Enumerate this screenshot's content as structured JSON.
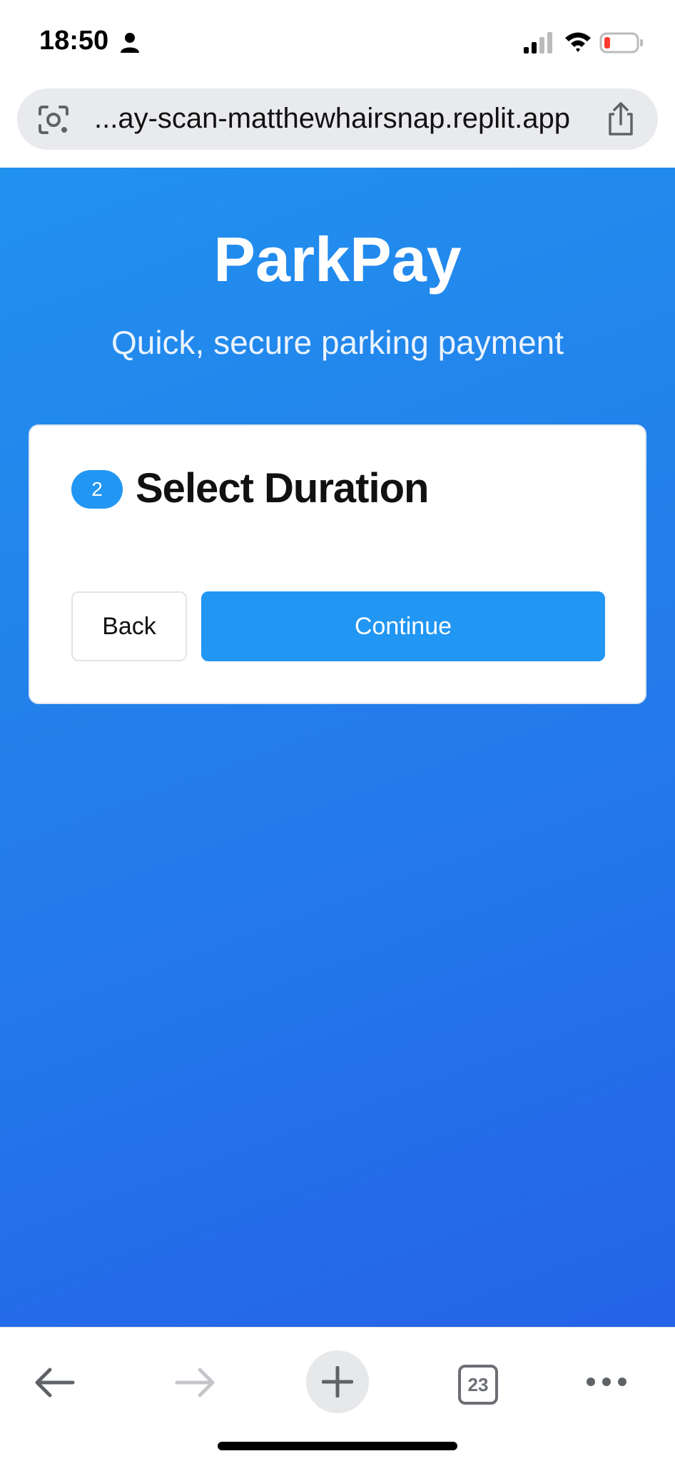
{
  "status_bar": {
    "time": "18:50",
    "icons": [
      "person-icon",
      "signal-icon",
      "wifi-icon",
      "battery-icon"
    ],
    "battery_color": "#ff3b30"
  },
  "browser": {
    "url": "...ay-scan-matthewhairsnap.replit.app",
    "tab_count": "23",
    "icons": [
      "lens-icon",
      "share-icon",
      "back-arrow-icon",
      "forward-arrow-icon",
      "plus-icon",
      "more-icon"
    ]
  },
  "app": {
    "title": "ParkPay",
    "subtitle": "Quick, secure parking payment",
    "accent_color": "#2196f3"
  },
  "card": {
    "step_number": "2",
    "step_title": "Select Duration",
    "back_label": "Back",
    "continue_label": "Continue"
  }
}
